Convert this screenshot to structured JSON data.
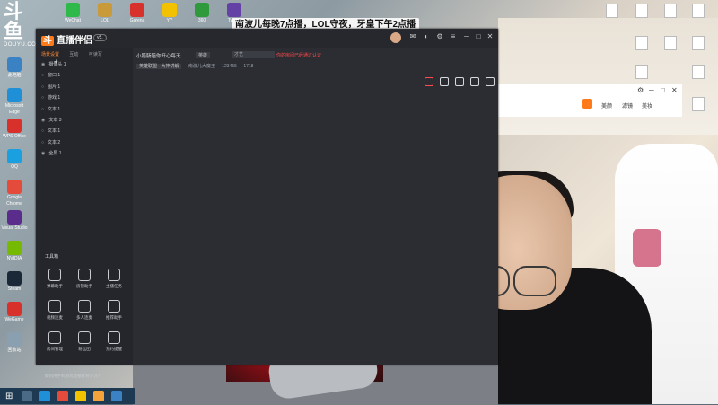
{
  "logo": {
    "mark": "斗鱼",
    "url": "DOUYU.COM"
  },
  "top_banner": "南波儿每晚7点播，LOL守夜，牙皇下午2点播",
  "app": {
    "name": "直播伴侣",
    "version_badge": "v5.",
    "tabs": [
      "场景设置",
      "互动",
      "可读写"
    ],
    "scenes": [
      {
        "label": "摄像头 1",
        "visible": true
      },
      {
        "label": "窗口 1",
        "visible": false
      },
      {
        "label": "图片 1",
        "visible": false
      },
      {
        "label": "游戏 1",
        "visible": false
      },
      {
        "label": "文本 1",
        "visible": false
      },
      {
        "label": "文本 3",
        "visible": true
      },
      {
        "label": "文本 1",
        "visible": false
      },
      {
        "label": "文本 2",
        "visible": false
      },
      {
        "label": "全屏 1",
        "visible": true
      }
    ],
    "tools_title": "工具箱",
    "tools": [
      "弹幕助手",
      "房管助手",
      "主播任务",
      "视频连麦",
      "多人连麦",
      "推荐助手",
      "房间管理",
      "粉丝团",
      "预约提醒"
    ],
    "bottom_hint": "如何用手机游戏直播教育学习?",
    "room": {
      "title": "小腊肠陪你开心每天",
      "tag": "英雄",
      "field": "才艺",
      "warning": "你的房间已经通过认证",
      "sub_tag": "英雄联盟 - 大神讲解",
      "sub_name": "南波儿大魔王",
      "room_id": "123455",
      "viewers": "1718"
    }
  },
  "mini_window": {
    "labels": [
      "美颜",
      "滤镜",
      "美妆"
    ]
  },
  "desktop_icons_left": [
    {
      "label": "此电脑",
      "color": "#3b82c4"
    },
    {
      "label": "Microsoft Edge",
      "color": "#1f8fd8"
    },
    {
      "label": "WPS Office",
      "color": "#d8312c"
    },
    {
      "label": "QQ",
      "color": "#1aa0e0"
    },
    {
      "label": "Google Chrome",
      "color": "#e44b3a"
    },
    {
      "label": "Visual Studio",
      "color": "#5a2d8c"
    },
    {
      "label": "NVIDIA",
      "color": "#75b900"
    },
    {
      "label": "Steam",
      "color": "#1b2838"
    },
    {
      "label": "WeGame",
      "color": "#d8312c"
    },
    {
      "label": "回收站",
      "color": "#8aa0b0"
    }
  ],
  "desktop_icons_top": [
    {
      "label": "WeChat",
      "color": "#2eb94a"
    },
    {
      "label": "LOL",
      "color": "#c89a3a"
    },
    {
      "label": "Garena",
      "color": "#d8312c"
    },
    {
      "label": "YY",
      "color": "#f2c200"
    },
    {
      "label": "360",
      "color": "#2f9a3c"
    },
    {
      "label": "Twitch",
      "color": "#6441a4"
    }
  ],
  "taskbar_items": [
    "start",
    "search",
    "edge",
    "chrome",
    "explorer",
    "store",
    "app"
  ]
}
